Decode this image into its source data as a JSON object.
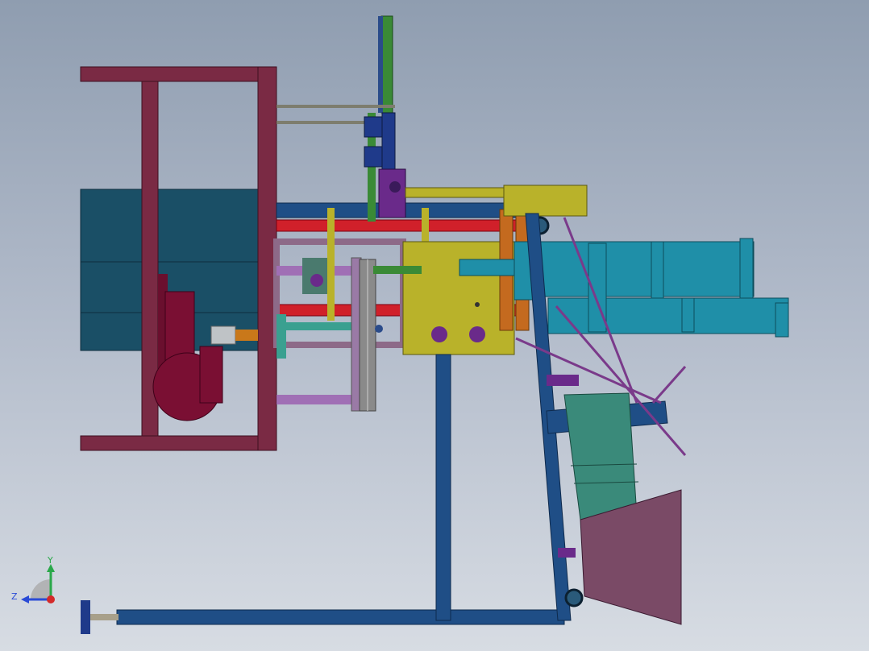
{
  "viewport": {
    "background_top": "#8f9db0",
    "background_bottom": "#d7dce3"
  },
  "triad": {
    "y_label": "Y",
    "z_label": "Z",
    "y_color": "#2aa84a",
    "z_color": "#2a4bd6",
    "x_color": "#d42a2a"
  },
  "colors": {
    "frame_maroon": "#7a2a44",
    "base_blue": "#1f4e86",
    "hopper_teal": "#1a4f66",
    "red_rod": "#d0202a",
    "cylinder_teal": "#1f8fa8",
    "yellow_plate": "#b9b22a",
    "purple_panel": "#6e4a66",
    "green_tube": "#3a8a36",
    "motor_maroon": "#7a0f33",
    "orange_plate": "#c46a1f"
  }
}
